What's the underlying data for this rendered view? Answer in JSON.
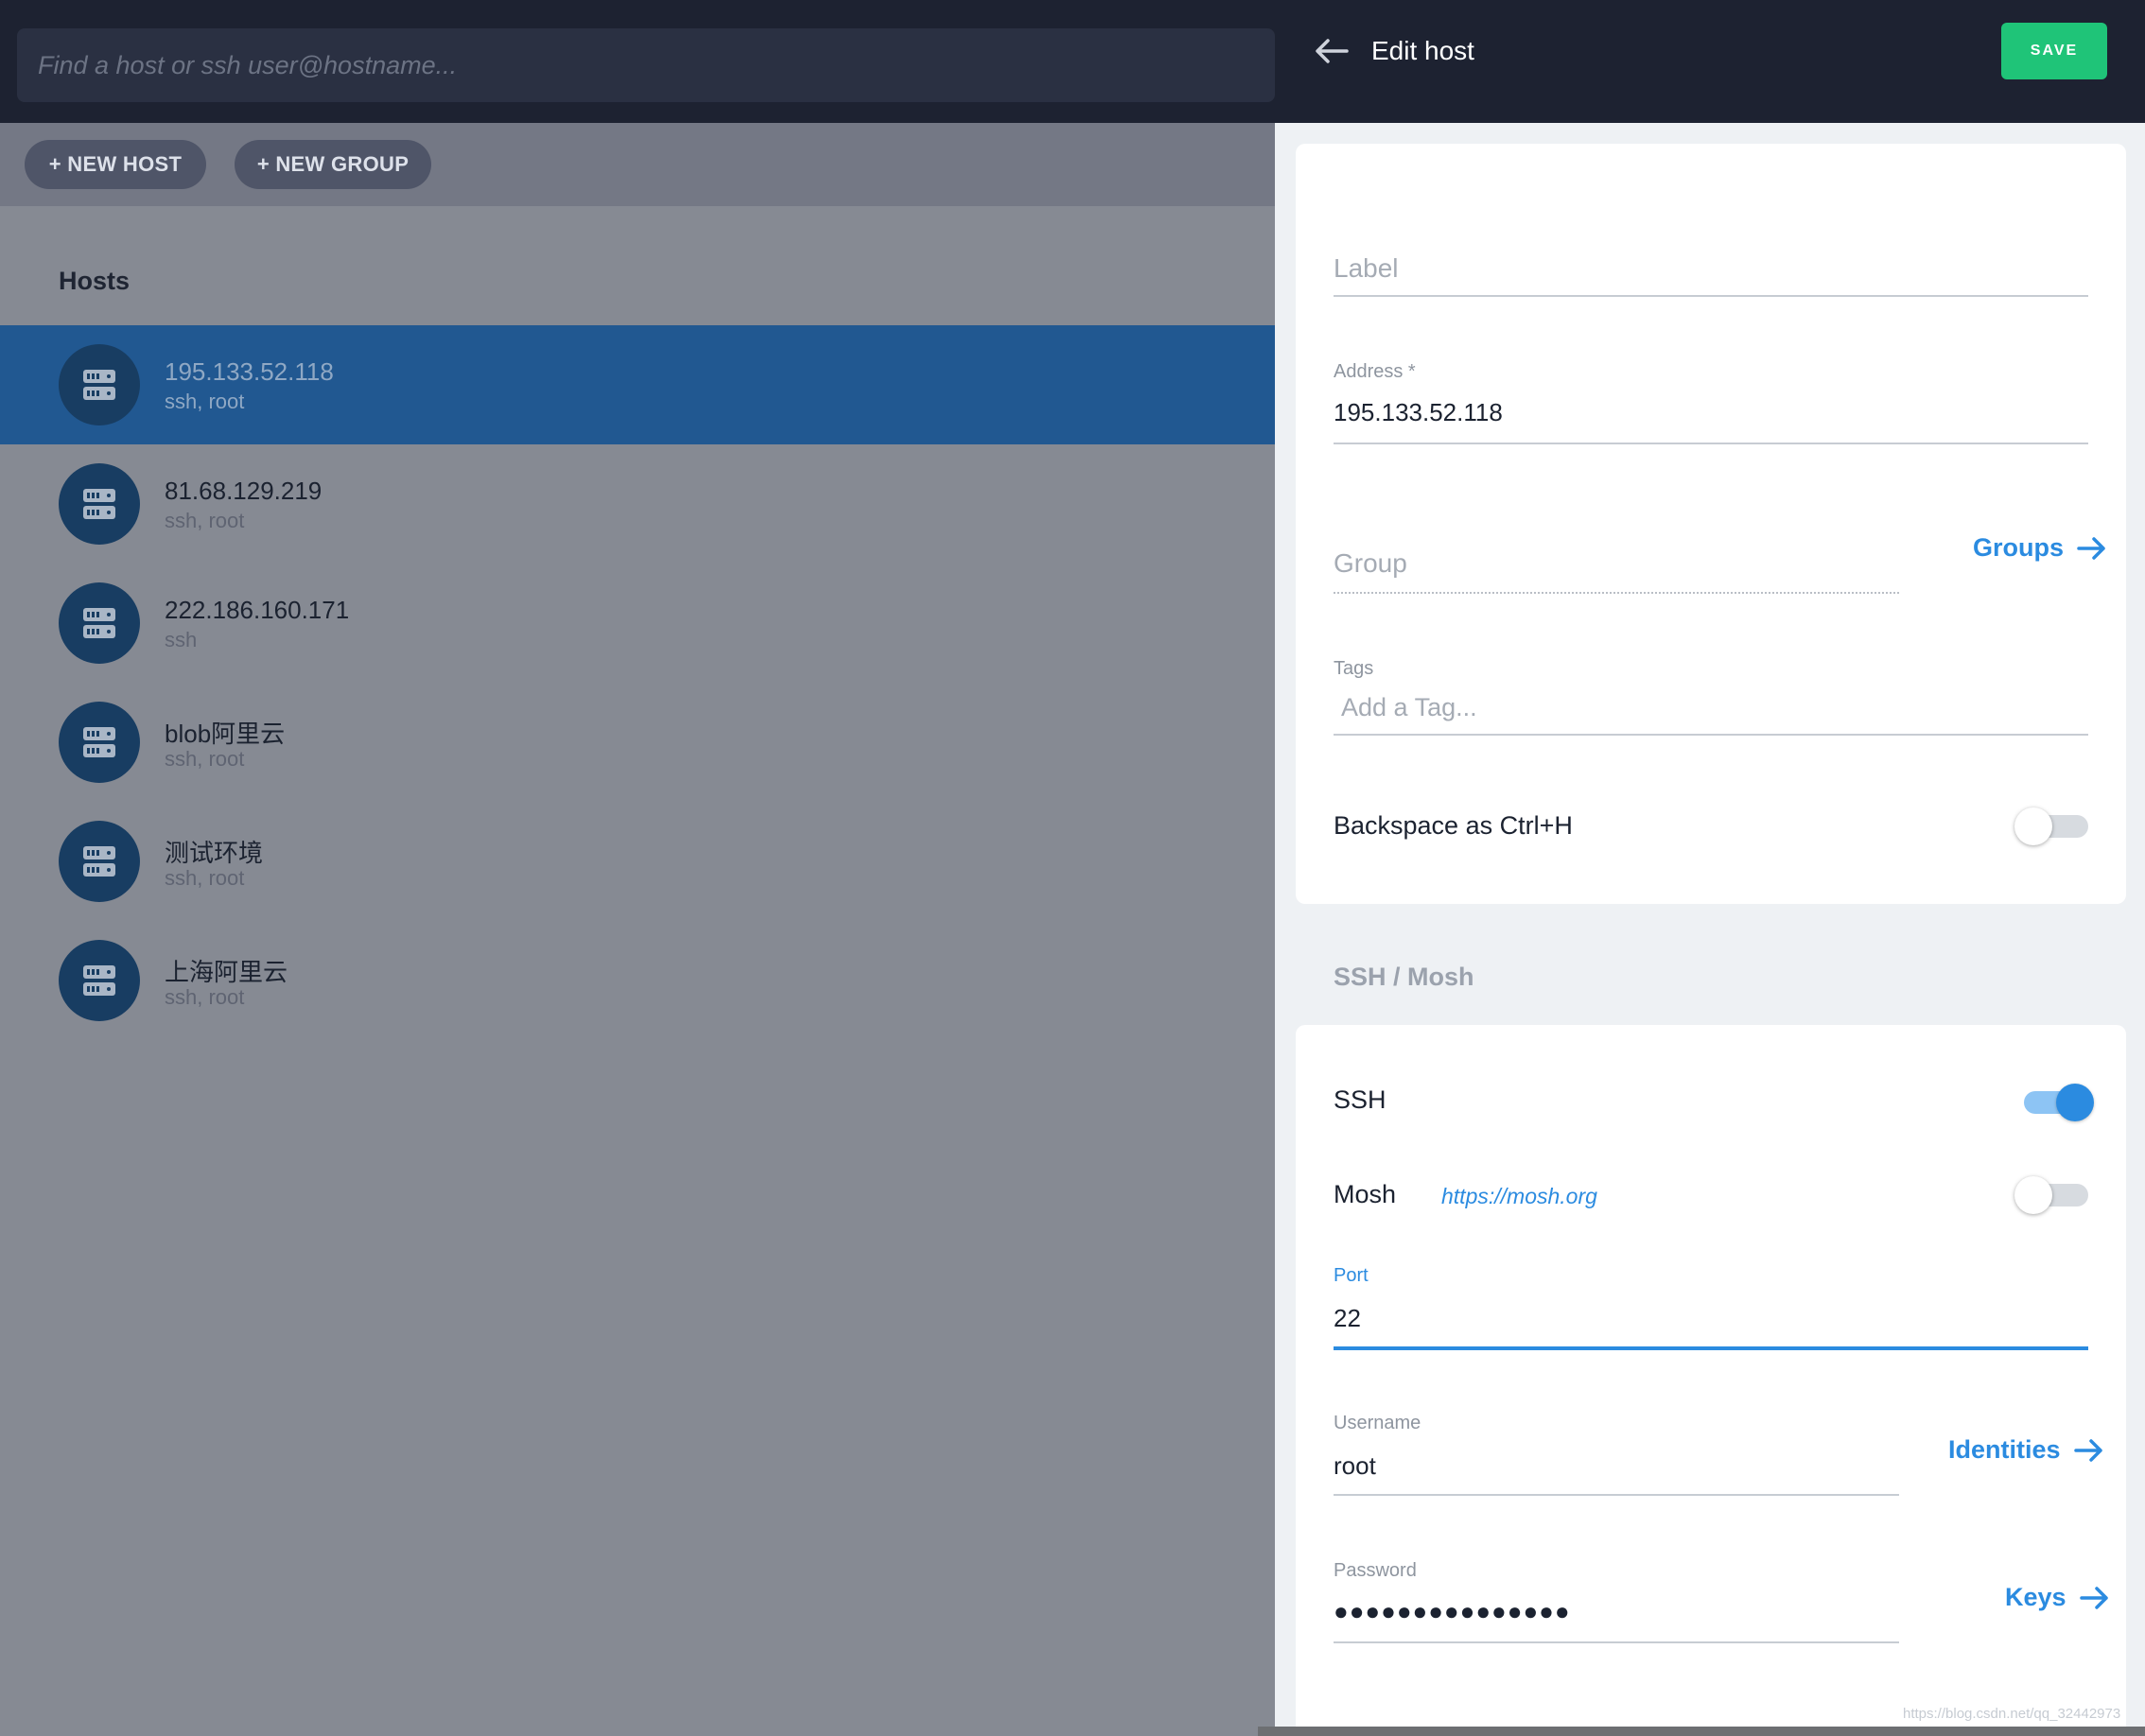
{
  "search": {
    "placeholder": "Find a host or ssh user@hostname..."
  },
  "toolbar": {
    "new_host": "+ NEW HOST",
    "new_group": "+ NEW GROUP"
  },
  "hosts_title": "Hosts",
  "hosts": [
    {
      "name": "195.133.52.118",
      "sub": "ssh, root",
      "selected": true
    },
    {
      "name": "81.68.129.219",
      "sub": "ssh, root"
    },
    {
      "name": "222.186.160.171",
      "sub": "ssh"
    },
    {
      "name": "blob阿里云",
      "sub": "ssh, root"
    },
    {
      "name": "测试环境",
      "sub": "ssh, root"
    },
    {
      "name": "上海阿里云",
      "sub": "ssh, root"
    }
  ],
  "panel": {
    "title": "Edit host",
    "save": "SAVE",
    "label_placeholder": "Label",
    "address_label": "Address *",
    "address_value": "195.133.52.118",
    "group_placeholder": "Group",
    "groups_link": "Groups",
    "tags_label": "Tags",
    "tags_placeholder": "Add a Tag...",
    "backspace_label": "Backspace as Ctrl+H",
    "backspace_on": false,
    "section_title": "SSH / Mosh",
    "ssh_label": "SSH",
    "ssh_on": true,
    "mosh_label": "Mosh",
    "mosh_link": "https://mosh.org",
    "mosh_on": false,
    "port_label": "Port",
    "port_value": "22",
    "username_label": "Username",
    "username_value": "root",
    "identities_link": "Identities",
    "password_label": "Password",
    "password_value": "●●●●●●●●●●●●●●●",
    "keys_link": "Keys"
  },
  "colors": {
    "accent": "#2b8be0",
    "save": "#1fc478",
    "selected_row": "#215891",
    "header": "#1d2231"
  },
  "watermark": "https://blog.csdn.net/qq_32442973"
}
